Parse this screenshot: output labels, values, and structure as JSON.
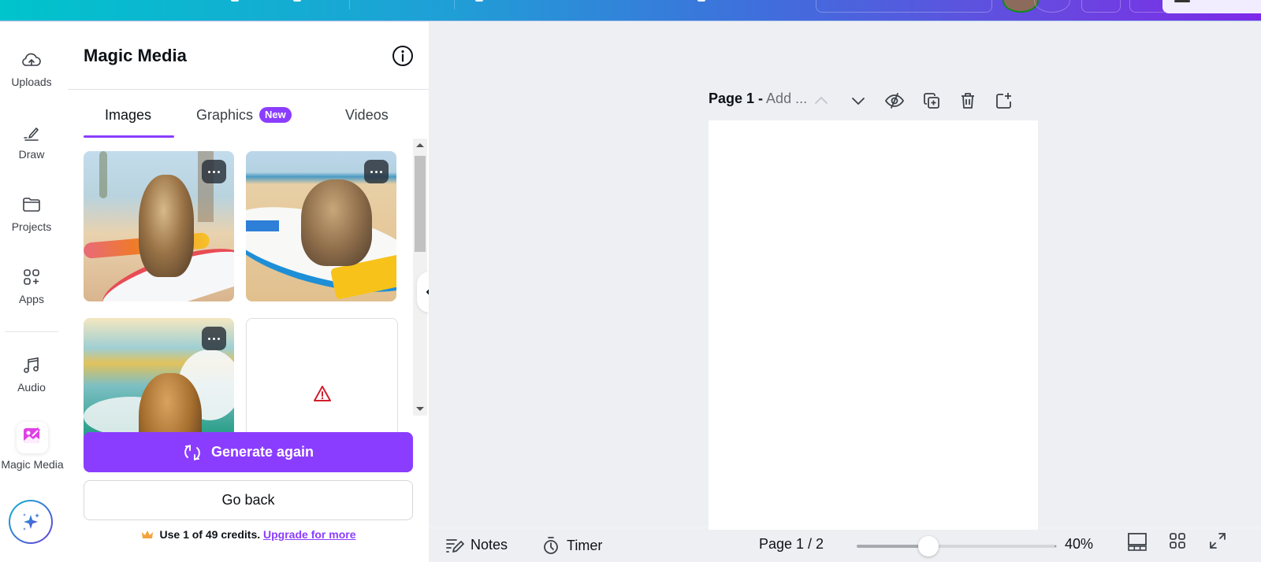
{
  "topbar": {
    "gradient_start": "#00c4cc",
    "gradient_end": "#7d2ae8"
  },
  "rail": {
    "items": [
      {
        "label": "Uploads",
        "icon": "cloud-upload-icon"
      },
      {
        "label": "Draw",
        "icon": "pen-draw-icon"
      },
      {
        "label": "Projects",
        "icon": "folder-icon"
      },
      {
        "label": "Apps",
        "icon": "apps-grid-plus-icon"
      },
      {
        "label": "Audio",
        "icon": "music-note-icon"
      },
      {
        "label": "Magic Media",
        "icon": "magic-media-icon"
      }
    ],
    "assistant_icon": "sparkle-assistant-icon"
  },
  "panel": {
    "title": "Magic Media",
    "info_icon": "info-icon",
    "tabs": [
      {
        "label": "Images",
        "active": true
      },
      {
        "label": "Graphics",
        "badge": "New",
        "active": false
      },
      {
        "label": "Videos",
        "active": false
      }
    ],
    "results": [
      {
        "description": "Long-haired tabby cat standing on colorful surfboard on beach",
        "status": "ok"
      },
      {
        "description": "Tabby cat lying on white and yellow surfboard on sand",
        "status": "ok"
      },
      {
        "description": "Tabby cat walking in front of ocean wave",
        "status": "ok"
      },
      {
        "description": "Failed generation",
        "status": "error",
        "icon": "warning-triangle-icon"
      }
    ],
    "generate_label": "Generate again",
    "back_label": "Go back",
    "credits_text": "Use 1 of 49 credits.",
    "upgrade_link": "Upgrade for more",
    "accent": "#8b3dff"
  },
  "canvas": {
    "page_label": "Page 1 -",
    "page_title_placeholder": "Add ...",
    "tools": [
      "chevron-up-icon",
      "chevron-down-icon",
      "hide-page-icon",
      "duplicate-page-icon",
      "delete-page-icon",
      "add-page-icon"
    ]
  },
  "footer": {
    "notes_label": "Notes",
    "timer_label": "Timer",
    "page_indicator": "Page 1 / 2",
    "zoom_percent": 40,
    "zoom_label": "40%",
    "zoom_slider_fraction": 0.36
  }
}
